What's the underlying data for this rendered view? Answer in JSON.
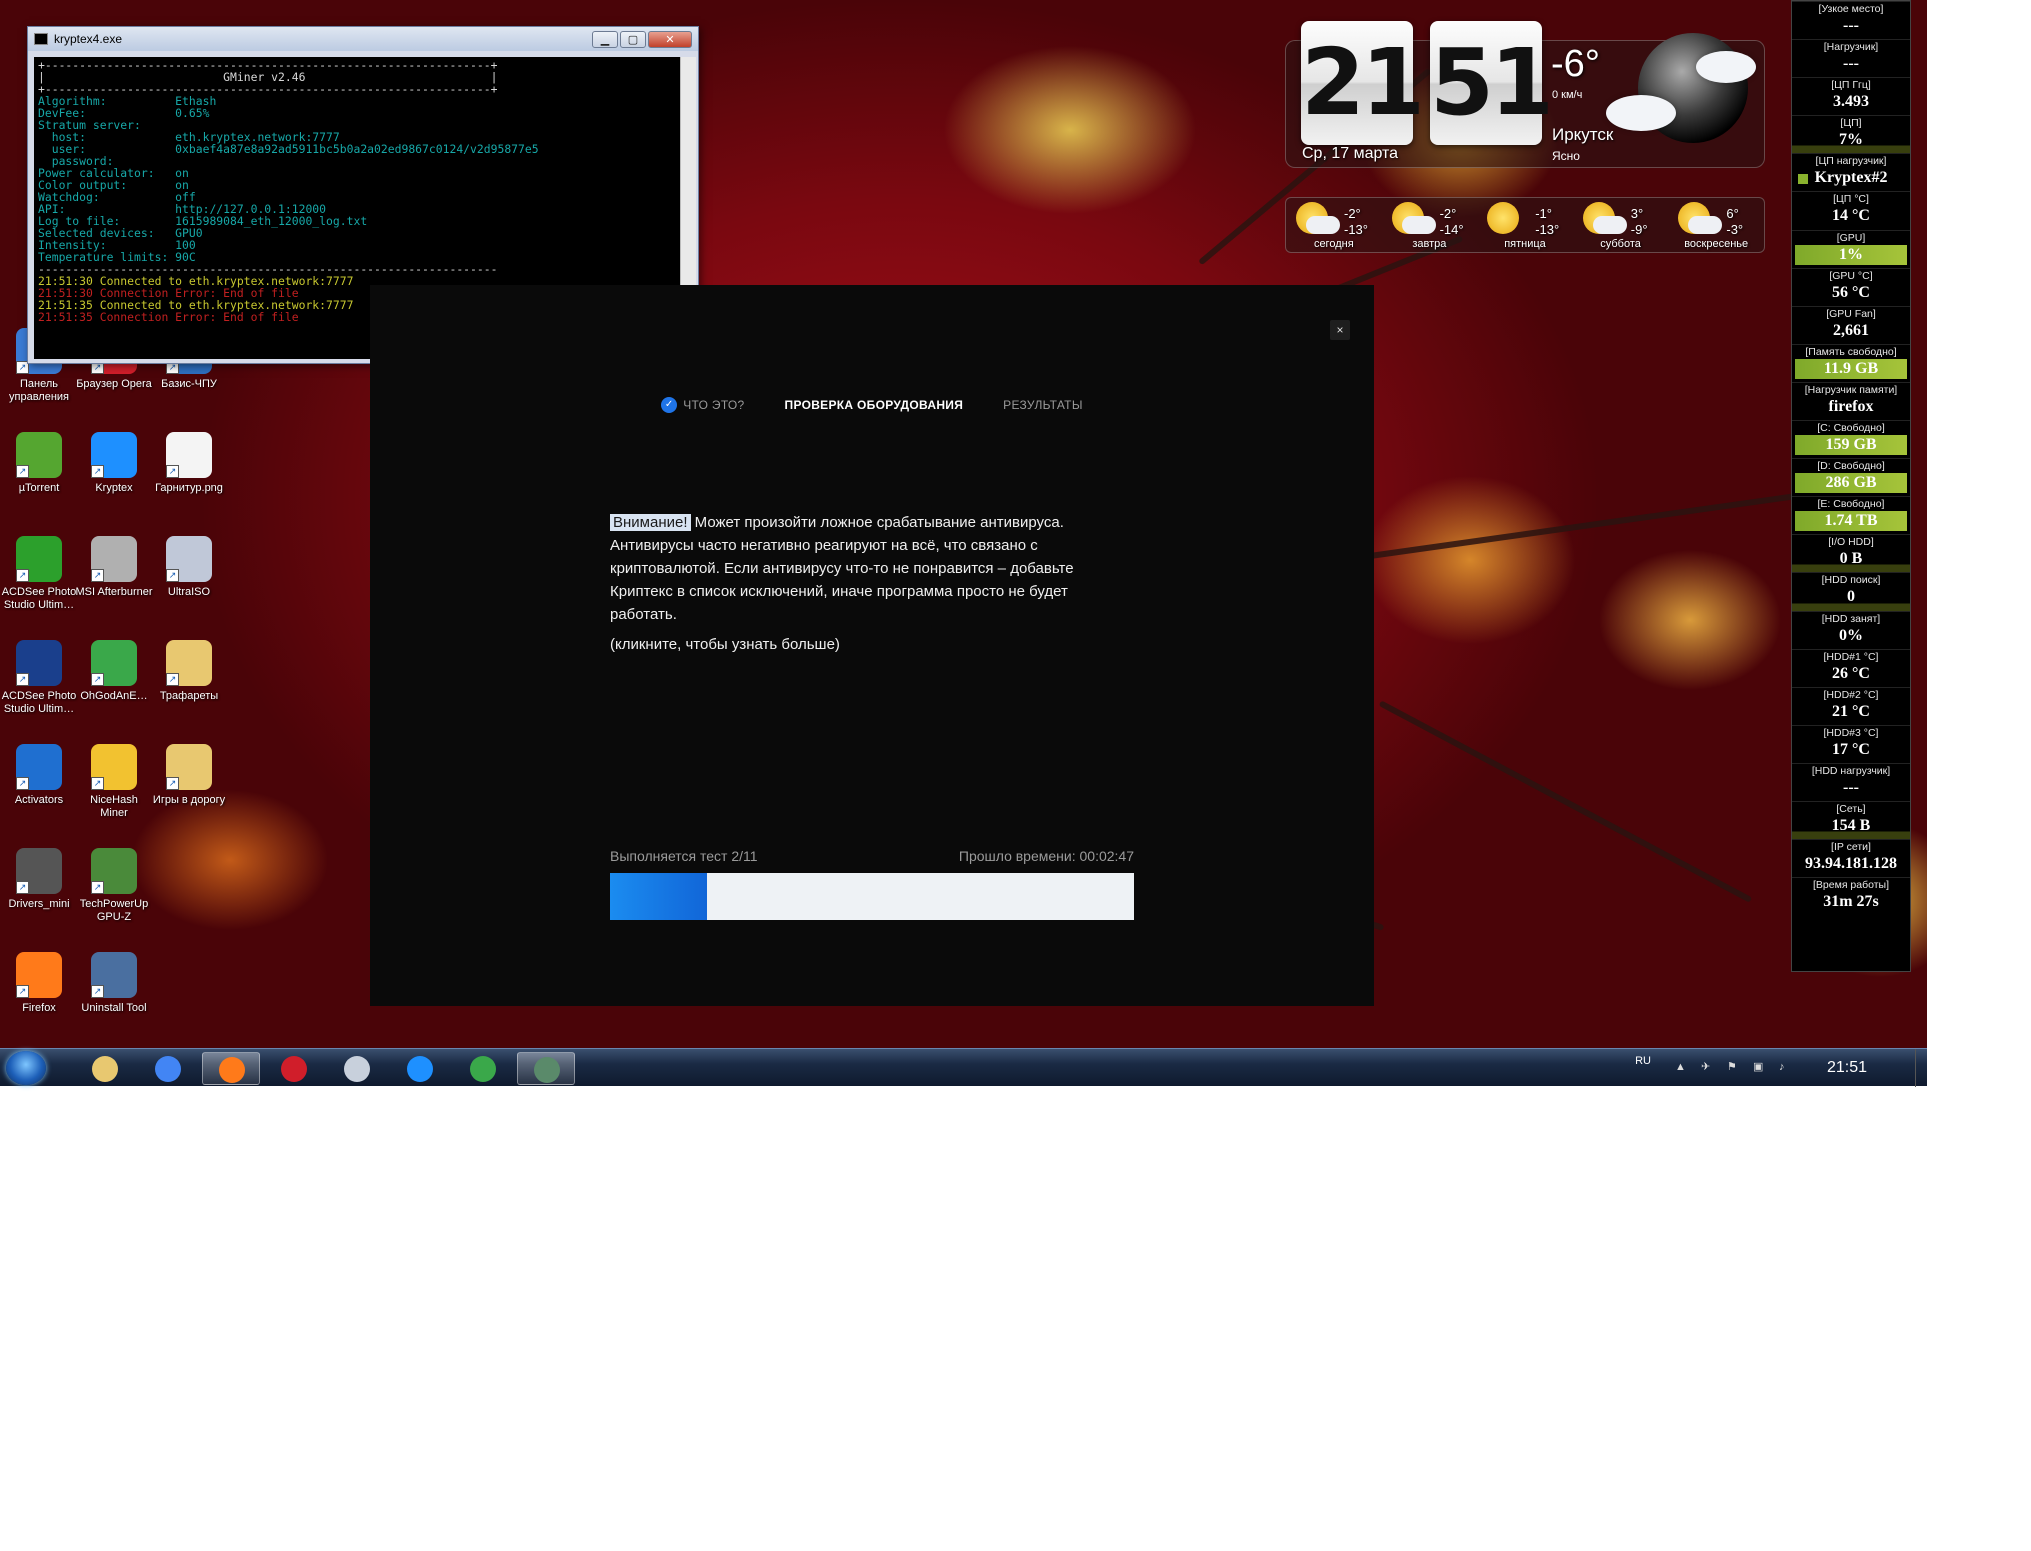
{
  "console": {
    "title": "kryptex4.exe",
    "lines": [
      {
        "text": "+-----------------------------------------------------------------+",
        "color": "white"
      },
      {
        "text": "|                          GMiner v2.46                           |",
        "color": "white"
      },
      {
        "text": "+-----------------------------------------------------------------+",
        "color": "white"
      },
      {
        "text": "Algorithm:          Ethash",
        "color": "cyan"
      },
      {
        "text": "DevFee:             0.65%",
        "color": "cyan"
      },
      {
        "text": "Stratum server:",
        "color": "cyan"
      },
      {
        "text": "  host:             eth.kryptex.network:7777",
        "color": "cyan"
      },
      {
        "text": "  user:             0xbaef4a87e8a92ad5911bc5b0a2a02ed9867c0124/v2d95877e5",
        "color": "cyan"
      },
      {
        "text": "  password:",
        "color": "cyan"
      },
      {
        "text": "Power calculator:   on",
        "color": "cyan"
      },
      {
        "text": "Color output:       on",
        "color": "cyan"
      },
      {
        "text": "Watchdog:           off",
        "color": "cyan"
      },
      {
        "text": "API:                http://127.0.0.1:12000",
        "color": "cyan"
      },
      {
        "text": "Log to file:        1615989084_eth_12000_log.txt",
        "color": "cyan"
      },
      {
        "text": "Selected devices:   GPU0",
        "color": "cyan"
      },
      {
        "text": "Intensity:          100",
        "color": "cyan"
      },
      {
        "text": "Temperature limits: 90C",
        "color": "cyan"
      },
      {
        "text": "-------------------------------------------------------------------",
        "color": "white"
      },
      {
        "text": "21:51:30 Connected to eth.kryptex.network:7777",
        "color": "yellow"
      },
      {
        "text": "21:51:30 Connection Error: End of file",
        "color": "red"
      },
      {
        "text": "21:51:35 Connected to eth.kryptex.network:7777",
        "color": "yellow"
      },
      {
        "text": "21:51:35 Connection Error: End of file",
        "color": "red"
      }
    ]
  },
  "desktop_icons": [
    {
      "label": "Панель управления",
      "color": "#3a7bd5"
    },
    {
      "label": "Браузер Opera",
      "color": "#d01e2a"
    },
    {
      "label": "Базис-ЧПУ",
      "color": "#2e6fc0"
    },
    {
      "label": "µTorrent",
      "color": "#55a630"
    },
    {
      "label": "Kryptex",
      "color": "#1e90ff"
    },
    {
      "label": "Гарнитур.png",
      "color": "#f4f4f4"
    },
    {
      "label": "ACDSee Photo Studio Ultim…",
      "color": "#2ca02c"
    },
    {
      "label": "MSI Afterburner",
      "color": "#b0b0b0"
    },
    {
      "label": "UltraISO",
      "color": "#c0c8d8"
    },
    {
      "label": "ACDSee Photo Studio Ultim…",
      "color": "#1a3f8c"
    },
    {
      "label": "OhGodAnE…",
      "color": "#3aa84a"
    },
    {
      "label": "Трафареты",
      "color": "#e8c870"
    },
    {
      "label": "Activators",
      "color": "#1f6fd0"
    },
    {
      "label": "NiceHash Miner",
      "color": "#f2c230"
    },
    {
      "label": "Игры в дорогу",
      "color": "#e8c870"
    },
    {
      "label": "Drivers_mini",
      "color": "#555555"
    },
    {
      "label": "TechPowerUp GPU-Z",
      "color": "#4a8a3a"
    },
    {
      "label": "Firefox",
      "color": "#ff7a1a"
    },
    {
      "label": "Uninstall Tool",
      "color": "#4a6fa0"
    }
  ],
  "dialog": {
    "steps": [
      {
        "label": "ЧТО ЭТО?",
        "state": "done"
      },
      {
        "label": "ПРОВЕРКА ОБОРУДОВАНИЯ",
        "state": "active"
      },
      {
        "label": "РЕЗУЛЬТАТЫ",
        "state": "pending"
      }
    ],
    "warning_label": "Внимание!",
    "warning_text": " Может произойти ложное срабатывание антивируса. Антивирусы часто негативно реагируют на всё, что связано с криптовалютой. Если антивирусу что-то не понравится – добавьте Криптекс в список исключений, иначе программа просто не будет работать.",
    "more_link": "(кликните, чтобы узнать больше)",
    "test_status": "Выполняется тест 2/11",
    "elapsed": "Прошло времени: 00:02:47",
    "progress_fraction": 0.185,
    "close_label": "×"
  },
  "clock": {
    "hours": "21",
    "minutes": "51",
    "date": "Ср, 17 марта",
    "temperature": "-6°",
    "wind": "0 км/ч",
    "city": "Иркутск",
    "condition": "Ясно"
  },
  "forecast": [
    {
      "day": "сегодня",
      "hi": "-2°",
      "lo": "-13°",
      "icon": "partly-cloudy-icon"
    },
    {
      "day": "завтра",
      "hi": "-2°",
      "lo": "-14°",
      "icon": "partly-cloudy-icon"
    },
    {
      "day": "пятница",
      "hi": "-1°",
      "lo": "-13°",
      "icon": "sun-icon"
    },
    {
      "day": "суббота",
      "hi": "3°",
      "lo": "-9°",
      "icon": "partly-cloudy-icon"
    },
    {
      "day": "воскресенье",
      "hi": "6°",
      "lo": "-3°",
      "icon": "partly-cloudy-icon"
    }
  ],
  "sysmon": [
    {
      "label": "[Узкое место]",
      "value": "---",
      "style": "plain"
    },
    {
      "label": "[Нагрузчик]",
      "value": "---",
      "style": "plain"
    },
    {
      "label": "[ЦП Ггц]",
      "value": "3.493",
      "style": "plain"
    },
    {
      "label": "[ЦП]",
      "value": "7%",
      "style": "graph"
    },
    {
      "label": "[ЦП нагрузчик]",
      "value": "Kryptex#2",
      "style": "square"
    },
    {
      "label": "[ЦП °C]",
      "value": "14 °C",
      "style": "plain"
    },
    {
      "label": "[GPU]",
      "value": "1%",
      "style": "bar"
    },
    {
      "label": "[GPU °C]",
      "value": "56 °C",
      "style": "plain"
    },
    {
      "label": "[GPU Fan]",
      "value": "2,661",
      "style": "plain"
    },
    {
      "label": "[Память свободно]",
      "value": "11.9 GB",
      "style": "bar"
    },
    {
      "label": "[Нагрузчик памяти]",
      "value": "firefox",
      "style": "plain"
    },
    {
      "label": "[C: Свободно]",
      "value": "159 GB",
      "style": "bar"
    },
    {
      "label": "[D: Свободно]",
      "value": "286 GB",
      "style": "bar"
    },
    {
      "label": "[E: Свободно]",
      "value": "1.74 TB",
      "style": "bar"
    },
    {
      "label": "[I/O HDD]",
      "value": "0 B",
      "style": "graph"
    },
    {
      "label": "[HDD поиск]",
      "value": "0",
      "style": "graph"
    },
    {
      "label": "[HDD занят]",
      "value": "0%",
      "style": "plain"
    },
    {
      "label": "[HDD#1 °C]",
      "value": "26 °C",
      "style": "plain"
    },
    {
      "label": "[HDD#2 °C]",
      "value": "21 °C",
      "style": "plain"
    },
    {
      "label": "[HDD#3 °C]",
      "value": "17 °C",
      "style": "plain"
    },
    {
      "label": "[HDD нагрузчик]",
      "value": "---",
      "style": "plain"
    },
    {
      "label": "[Сеть]",
      "value": "154 B",
      "style": "graph"
    },
    {
      "label": "[IP сети]",
      "value": "93.94.181.128",
      "style": "plain"
    },
    {
      "label": "[Время работы]",
      "value": "31m 27s",
      "style": "plain"
    }
  ],
  "taskbar": {
    "apps": [
      {
        "name": "explorer",
        "icon": "folder-icon",
        "color": "#e8c870"
      },
      {
        "name": "chrome",
        "icon": "chrome-icon",
        "color": "#4285f4"
      },
      {
        "name": "firefox",
        "icon": "firefox-icon",
        "color": "#ff7a1a"
      },
      {
        "name": "opera",
        "icon": "opera-icon",
        "color": "#d01e2a"
      },
      {
        "name": "calculator",
        "icon": "calculator-icon",
        "color": "#c8d0dc"
      },
      {
        "name": "kryptex",
        "icon": "kryptex-icon",
        "color": "#1e90ff"
      },
      {
        "name": "ohgodanethlargement",
        "icon": "pill-icon",
        "color": "#3aa84a"
      },
      {
        "name": "console",
        "icon": "console-icon",
        "color": "#5a8a6a"
      }
    ],
    "language": "RU",
    "time": "21:51"
  }
}
